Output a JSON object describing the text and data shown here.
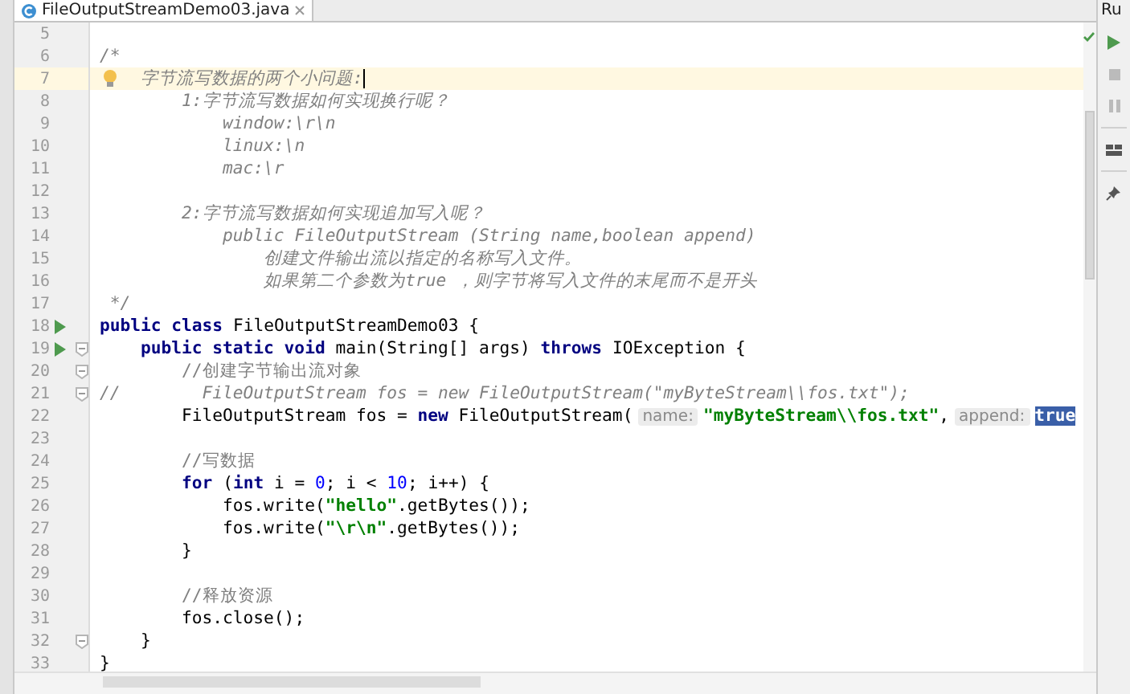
{
  "tab": {
    "title": "FileOutputStreamDemo03.java",
    "selected": true
  },
  "run_panel": {
    "title": "Ru"
  },
  "lines": [
    {
      "number": "5",
      "run": false,
      "fold": false,
      "current": false
    },
    {
      "number": "6",
      "run": false,
      "fold": false,
      "current": false,
      "tokens": [
        {
          "kind": "doc",
          "text": "/*"
        }
      ]
    },
    {
      "number": "7",
      "run": false,
      "fold": false,
      "current": true,
      "tokens": [
        {
          "kind": "doc",
          "text": "    字节流写数据的两个小问题:"
        }
      ]
    },
    {
      "number": "8",
      "run": false,
      "fold": false,
      "current": false,
      "tokens": [
        {
          "kind": "doc",
          "text": "        1:字节流写数据如何实现换行呢？"
        }
      ]
    },
    {
      "number": "9",
      "run": false,
      "fold": false,
      "current": false,
      "tokens": [
        {
          "kind": "doc",
          "text": "            window:\\r\\n"
        }
      ]
    },
    {
      "number": "10",
      "run": false,
      "fold": false,
      "current": false,
      "tokens": [
        {
          "kind": "doc",
          "text": "            linux:\\n"
        }
      ]
    },
    {
      "number": "11",
      "run": false,
      "fold": false,
      "current": false,
      "tokens": [
        {
          "kind": "doc",
          "text": "            mac:\\r"
        }
      ]
    },
    {
      "number": "12",
      "run": false,
      "fold": false,
      "current": false
    },
    {
      "number": "13",
      "run": false,
      "fold": false,
      "current": false,
      "tokens": [
        {
          "kind": "doc",
          "text": "        2:字节流写数据如何实现追加写入呢？"
        }
      ]
    },
    {
      "number": "14",
      "run": false,
      "fold": false,
      "current": false,
      "tokens": [
        {
          "kind": "doc",
          "text": "            public FileOutputStream (String name,boolean append)"
        }
      ]
    },
    {
      "number": "15",
      "run": false,
      "fold": false,
      "current": false,
      "tokens": [
        {
          "kind": "doc",
          "text": "                创建文件输出流以指定的名称写入文件。"
        }
      ]
    },
    {
      "number": "16",
      "run": false,
      "fold": false,
      "current": false,
      "tokens": [
        {
          "kind": "doc",
          "text": "                如果第二个参数为true ，则字节将写入文件的末尾而不是开头"
        }
      ]
    },
    {
      "number": "17",
      "run": false,
      "fold": false,
      "current": false,
      "tokens": [
        {
          "kind": "doc",
          "text": " */"
        }
      ]
    },
    {
      "number": "18",
      "run": true,
      "fold": false,
      "current": false,
      "tokens": [
        {
          "kind": "keyword",
          "text": "public class"
        },
        {
          "kind": "plain",
          "text": " FileOutputStreamDemo03 {"
        }
      ]
    },
    {
      "number": "19",
      "run": true,
      "fold": true,
      "current": false,
      "tokens": [
        {
          "kind": "keyword",
          "text": "    public static void"
        },
        {
          "kind": "plain",
          "text": " main(String[] args) "
        },
        {
          "kind": "keyword",
          "text": "throws"
        },
        {
          "kind": "plain",
          "text": " IOException {"
        }
      ]
    },
    {
      "number": "20",
      "run": false,
      "fold": true,
      "current": false,
      "tokens": [
        {
          "kind": "linecomment",
          "text": "        //创建字节输出流对象"
        }
      ]
    },
    {
      "number": "21",
      "run": false,
      "fold": true,
      "current": false,
      "tokens": [
        {
          "kind": "comment",
          "text": "//        FileOutputStream fos = new FileOutputStream(\"myByteStream\\\\fos.txt\");"
        }
      ]
    },
    {
      "number": "22",
      "run": false,
      "fold": false,
      "current": false,
      "tokens": [
        {
          "kind": "plain",
          "text": "        FileOutputStream fos = "
        },
        {
          "kind": "keyword",
          "text": "new"
        },
        {
          "kind": "plain",
          "text": " FileOutputStream("
        },
        {
          "kind": "hint",
          "text": "name:"
        },
        {
          "kind": "string",
          "text": "\"myByteStream\\\\fos.txt\""
        },
        {
          "kind": "plain",
          "text": ","
        },
        {
          "kind": "hint",
          "text": "append:"
        },
        {
          "kind": "selected",
          "text": "true"
        }
      ]
    },
    {
      "number": "23",
      "run": false,
      "fold": false,
      "current": false
    },
    {
      "number": "24",
      "run": false,
      "fold": false,
      "current": false,
      "tokens": [
        {
          "kind": "linecomment",
          "text": "        //写数据"
        }
      ]
    },
    {
      "number": "25",
      "run": false,
      "fold": false,
      "current": false,
      "tokens": [
        {
          "kind": "keyword",
          "text": "        for"
        },
        {
          "kind": "plain",
          "text": " ("
        },
        {
          "kind": "keyword",
          "text": "int"
        },
        {
          "kind": "plain",
          "text": " i = "
        },
        {
          "kind": "number",
          "text": "0"
        },
        {
          "kind": "plain",
          "text": "; i < "
        },
        {
          "kind": "number",
          "text": "10"
        },
        {
          "kind": "plain",
          "text": "; i++) {"
        }
      ]
    },
    {
      "number": "26",
      "run": false,
      "fold": false,
      "current": false,
      "tokens": [
        {
          "kind": "plain",
          "text": "            fos.write("
        },
        {
          "kind": "string",
          "text": "\"hello\""
        },
        {
          "kind": "plain",
          "text": ".getBytes());"
        }
      ]
    },
    {
      "number": "27",
      "run": false,
      "fold": false,
      "current": false,
      "tokens": [
        {
          "kind": "plain",
          "text": "            fos.write("
        },
        {
          "kind": "string",
          "text": "\"\\r\\n\""
        },
        {
          "kind": "plain",
          "text": ".getBytes());"
        }
      ]
    },
    {
      "number": "28",
      "run": false,
      "fold": false,
      "current": false,
      "tokens": [
        {
          "kind": "plain",
          "text": "        }"
        }
      ]
    },
    {
      "number": "29",
      "run": false,
      "fold": false,
      "current": false
    },
    {
      "number": "30",
      "run": false,
      "fold": false,
      "current": false,
      "tokens": [
        {
          "kind": "linecomment",
          "text": "        //释放资源"
        }
      ]
    },
    {
      "number": "31",
      "run": false,
      "fold": false,
      "current": false,
      "tokens": [
        {
          "kind": "plain",
          "text": "        fos.close();"
        }
      ]
    },
    {
      "number": "32",
      "run": false,
      "fold": true,
      "current": false,
      "tokens": [
        {
          "kind": "plain",
          "text": "    }"
        }
      ]
    },
    {
      "number": "33",
      "run": false,
      "fold": false,
      "current": false,
      "tokens": [
        {
          "kind": "plain",
          "text": "}"
        }
      ]
    }
  ]
}
